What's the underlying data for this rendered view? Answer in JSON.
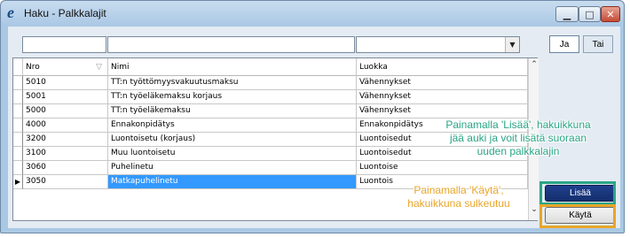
{
  "window": {
    "title": "Haku - Palkkalajit",
    "app_icon": "e"
  },
  "title_buttons": {
    "minimize": "▁",
    "maximize": "□",
    "close": "✕"
  },
  "filters": {
    "col1": "",
    "col2": "",
    "col3": ""
  },
  "toggle": {
    "ja": "Ja",
    "tai": "Tai"
  },
  "table": {
    "columns": [
      "Nro",
      "Nimi",
      "Luokka"
    ],
    "rows": [
      {
        "nro": "5010",
        "nimi": "TT:n työttömyysvakuutusmaksu",
        "luokka": "Vähennykset"
      },
      {
        "nro": "5001",
        "nimi": "TT:n työeläkemaksu korjaus",
        "luokka": "Vähennykset"
      },
      {
        "nro": "5000",
        "nimi": "TT:n työeläkemaksu",
        "luokka": "Vähennykset"
      },
      {
        "nro": "4000",
        "nimi": "Ennakonpidätys",
        "luokka": "Ennakonpidätys"
      },
      {
        "nro": "3200",
        "nimi": "Luontoisetu (korjaus)",
        "luokka": "Luontoisedut"
      },
      {
        "nro": "3100",
        "nimi": "Muu luontoisetu",
        "luokka": "Luontoisedut"
      },
      {
        "nro": "3060",
        "nimi": "Puhelinetu",
        "luokka": "Luontoise"
      },
      {
        "nro": "3050",
        "nimi": "Matkapuhelinetu",
        "luokka": "Luontois"
      }
    ],
    "selected_row": 7,
    "current_row_marker": "▶"
  },
  "buttons": {
    "lisaa": "Lisää",
    "kayta": "Käytä"
  },
  "annotations": {
    "green": [
      "Painamalla 'Lisää', hakuikkuna",
      "jää auki ja voit lisätä suoraan",
      "uuden palkkalajin"
    ],
    "orange": [
      "Painamalla 'Käytä',",
      "hakuikkuna sulkeutuu"
    ]
  },
  "colors": {
    "selection": "#3399ff",
    "green_annotation": "#29a585",
    "orange_annotation": "#e8a62a",
    "lisaa_button": "#1f3f8c"
  }
}
